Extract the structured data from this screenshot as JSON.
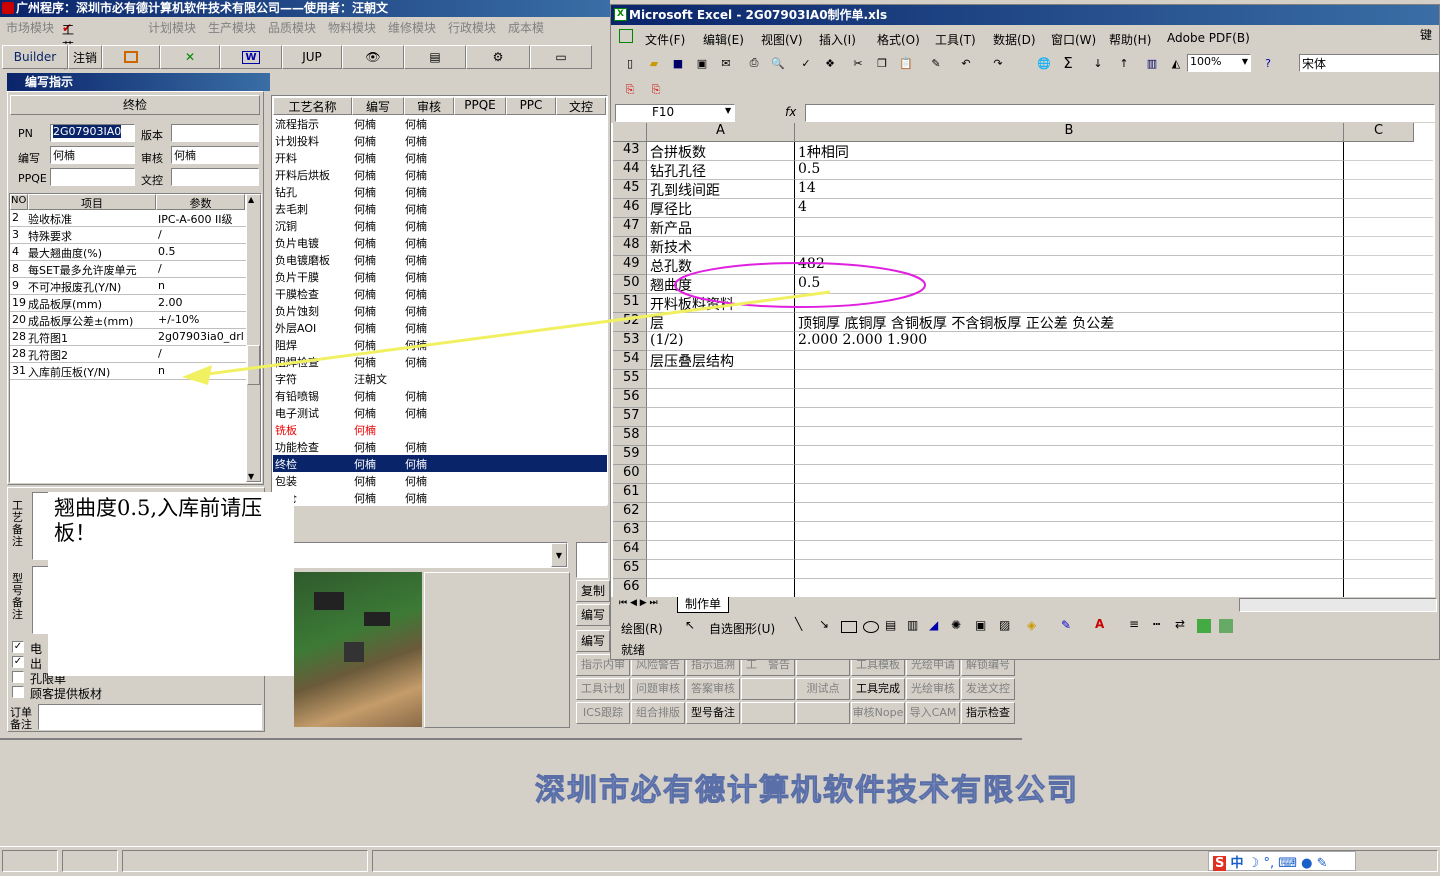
{
  "app": {
    "title": "广州程序：深圳市必有德计算机软件技术有限公司——使用者：汪朝文",
    "menu": [
      "市场模块",
      "工艺模块",
      "计划模块",
      "生产模块",
      "品质模块",
      "物料模块",
      "维修模块",
      "行政模块",
      "成本模"
    ],
    "toolbar": {
      "builder": "Builder",
      "logout": "注销",
      "jup": "JUP"
    },
    "panel_title": "编写指示",
    "section": "终检",
    "pn_label": "PN",
    "pn_value": "2G07903IA0",
    "version_label": "版本",
    "writer_label": "编写",
    "writer_value": "何楠",
    "reviewer_label": "审核",
    "reviewer_value": "何楠",
    "ppqe_label": "PPQE",
    "wenkong_label": "文控",
    "grid_headers": [
      "NO",
      "项目",
      "参数"
    ],
    "grid_rows": [
      [
        "2",
        "验收标准",
        "IPC-A-600 II级"
      ],
      [
        "3",
        "特殊要求",
        "/"
      ],
      [
        "4",
        "最大翘曲度(%)",
        "0.5"
      ],
      [
        "8",
        "每SET最多允许废单元",
        "/"
      ],
      [
        "9",
        "不可冲报废孔(Y/N)",
        "n"
      ],
      [
        "19",
        "成品板厚(mm)",
        "2.00"
      ],
      [
        "20",
        "成品板厚公差±(mm)",
        "+/-10%"
      ],
      [
        "28",
        "孔符图1",
        "2g07903ia0_drl"
      ],
      [
        "28",
        "孔符图2",
        "/"
      ],
      [
        "31",
        "入库前压板(Y/N)",
        "n"
      ]
    ],
    "proc_headers": [
      "工艺名称",
      "编写",
      "审核",
      "PPQE",
      "PPC",
      "文控"
    ],
    "proc_rows": [
      [
        "流程指示",
        "何楠",
        "何楠"
      ],
      [
        "计划投料",
        "何楠",
        "何楠"
      ],
      [
        "开料",
        "何楠",
        "何楠"
      ],
      [
        "开料后烘板",
        "何楠",
        "何楠"
      ],
      [
        "钻孔",
        "何楠",
        "何楠"
      ],
      [
        "去毛刺",
        "何楠",
        "何楠"
      ],
      [
        "沉铜",
        "何楠",
        "何楠"
      ],
      [
        "负片电镀",
        "何楠",
        "何楠"
      ],
      [
        "负电镀磨板",
        "何楠",
        "何楠"
      ],
      [
        "负片干膜",
        "何楠",
        "何楠"
      ],
      [
        "干膜检查",
        "何楠",
        "何楠"
      ],
      [
        "负片蚀刻",
        "何楠",
        "何楠"
      ],
      [
        "外层AOI",
        "何楠",
        "何楠"
      ],
      [
        "阻焊",
        "何楠",
        "何楠"
      ],
      [
        "阻焊检查",
        "何楠",
        "何楠"
      ],
      [
        "字符",
        "汪朝文",
        ""
      ],
      [
        "有铅喷锡",
        "何楠",
        "何楠"
      ],
      [
        "电子测试",
        "何楠",
        "何楠"
      ],
      [
        "铣板",
        "何楠",
        ""
      ],
      [
        "功能检查",
        "何楠",
        "何楠"
      ],
      [
        "终检",
        "何楠",
        "何楠"
      ],
      [
        "包装",
        "何楠",
        "何楠"
      ],
      [
        "入仓",
        "何楠",
        "何楠"
      ]
    ],
    "note_text": "翘曲度0.5,入库前请压板！",
    "side_labels": [
      "工艺备注",
      "型号备注",
      "订单备注"
    ],
    "checkboxes": [
      {
        "label": "电",
        "checked": true
      },
      {
        "label": "出",
        "checked": true
      },
      {
        "label": "孔限单",
        "checked": false
      },
      {
        "label": "顾客提供板材",
        "checked": false
      }
    ],
    "right_buttons": [
      "复制",
      "编写",
      "编写"
    ],
    "bottom_buttons": [
      [
        "指示内审",
        "风险警告",
        "指示追溯",
        "工　警告",
        "",
        "工具模板",
        "光绘申请",
        "解锁编号"
      ],
      [
        "工具计划",
        "问题审核",
        "答案审核",
        "",
        "测试点",
        "工具完成",
        "光绘审核",
        "发送文控"
      ],
      [
        "ICS跟踪",
        "组合排版",
        "型号备注",
        "",
        "",
        "审核Nope",
        "导入CAM",
        "指示检查"
      ]
    ],
    "company": "深圳市必有德计算机软件技术有限公司"
  },
  "excel": {
    "title": "Microsoft Excel - 2G07903IA0制作单.xls",
    "menu": [
      "文件(F)",
      "编辑(E)",
      "视图(V)",
      "插入(I)",
      "格式(O)",
      "工具(T)",
      "数据(D)",
      "窗口(W)",
      "帮助(H)",
      "Adobe PDF(B)"
    ],
    "right_menu": "键",
    "zoom": "100%",
    "font": "宋体",
    "cell_ref": "F10",
    "fx": "fx",
    "col_headers": [
      "A",
      "B",
      "C"
    ],
    "rows": [
      [
        "43",
        "合拼板数",
        "1种相同"
      ],
      [
        "44",
        "钻孔孔径",
        "0.5"
      ],
      [
        "45",
        "孔到线间距",
        "14"
      ],
      [
        "46",
        "厚径比",
        "4"
      ],
      [
        "47",
        "新产品",
        ""
      ],
      [
        "48",
        "新技术",
        ""
      ],
      [
        "49",
        "总孔数",
        "482"
      ],
      [
        "50",
        "翘曲度",
        "0.5"
      ],
      [
        "51",
        "开料板料资料",
        ""
      ],
      [
        "52",
        "层",
        "顶铜厚  底铜厚  含铜板厚  不含铜板厚  正公差  负公差"
      ],
      [
        "53",
        "(1/2)",
        "2.000   2.000    1.900"
      ],
      [
        "54",
        "层压叠层结构",
        ""
      ],
      [
        "55",
        "",
        ""
      ],
      [
        "56",
        "",
        ""
      ],
      [
        "57",
        "",
        ""
      ],
      [
        "58",
        "",
        ""
      ],
      [
        "59",
        "",
        ""
      ],
      [
        "60",
        "",
        ""
      ],
      [
        "61",
        "",
        ""
      ],
      [
        "62",
        "",
        ""
      ],
      [
        "63",
        "",
        ""
      ],
      [
        "64",
        "",
        ""
      ],
      [
        "65",
        "",
        ""
      ],
      [
        "66",
        "",
        ""
      ]
    ],
    "sheet_tab": "制作单",
    "draw_label": "绘图(R)",
    "autoshape": "自选图形(U)",
    "status": "就绪"
  },
  "taskbar": {
    "ime": "中"
  }
}
